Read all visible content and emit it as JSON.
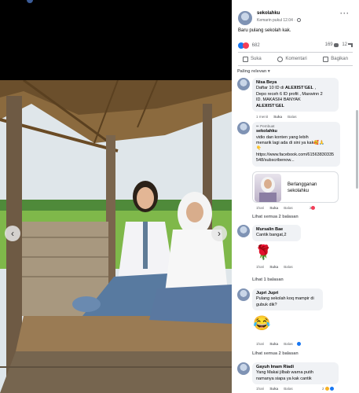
{
  "colors": {
    "accent": "#1877f2",
    "love": "#f33e58",
    "muted": "#65676b",
    "comment_bg": "#f0f2f5"
  },
  "viewer": {
    "prev_icon": "chevron-left-icon",
    "next_icon": "chevron-right-icon",
    "prev_glyph": "‹",
    "next_glyph": "›"
  },
  "post": {
    "author": "sekolahku",
    "time": "Kemarin pukul 12.04 · ",
    "more_glyph": "···",
    "caption": "Baru pulang sekolah kak.",
    "reaction_count": "682",
    "comment_count": "169",
    "share_count": "12"
  },
  "actions": {
    "like": "Suka",
    "comment": "Komentari",
    "share": "Bagikan"
  },
  "sort_label": "Paling relevan ▾",
  "comments": [
    {
      "name": "Nisa Beya",
      "lines": [
        "Daftar 10 ID di 𝐀𝐋𝐄𝐗𝐈𝐒𝐓'𝐆𝐄𝐋 ,",
        "Depo receh 6 ID profit , Maxwinn 2",
        "ID. MAKASIH BANYAK",
        "𝐀𝐋𝐄𝐗𝐈𝐒𝐓'𝐆𝐄𝐋"
      ],
      "time": "1 menit",
      "like": "Suka",
      "reply": "Balas"
    },
    {
      "creator_tag": "✏ Pembuat",
      "name": "sekolahku",
      "lines": [
        "vidio dan konten yang lebih",
        "menarik lagi ada di sini ya kak🥰🙏",
        "👇"
      ],
      "link": "https://www.facebook.com/61563830335548/subscribenow...",
      "card_text": "Berlangganan sekolahku",
      "time": "1hari",
      "like": "Suka",
      "reply": "Balas",
      "react_count": "2",
      "replies": "Lihat semua 2 balasan"
    },
    {
      "name": "Mursalin Bae",
      "lines": [
        "Cantik bangat,2"
      ],
      "emoji": "🌹",
      "time": "1hari",
      "like": "Suka",
      "reply": "Balas",
      "replies": "Lihat 1 balasan"
    },
    {
      "name": "Jupri Jupri",
      "lines": [
        "Pulang sekolah koq mampir di",
        "gubuk dik?"
      ],
      "emoji": "😂",
      "time": "1hari",
      "like": "Suka",
      "reply": "Balas",
      "replies": "Lihat semua 2 balasan"
    },
    {
      "name": "Gayuh Imam Riadi",
      "lines": [
        "Yang Makai jilbab warna putih",
        "namanya siapa ya kak cantik"
      ],
      "time": "1hari",
      "like": "Suka",
      "reply": "Balas",
      "react_count": "2"
    }
  ]
}
